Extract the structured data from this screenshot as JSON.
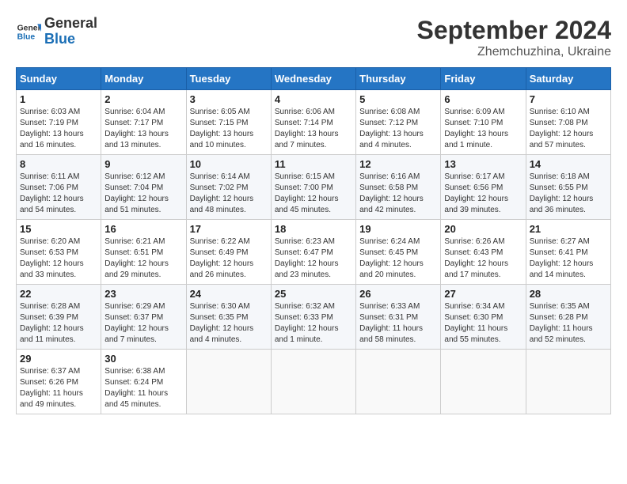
{
  "header": {
    "logo_general": "General",
    "logo_blue": "Blue",
    "month_title": "September 2024",
    "location": "Zhemchuzhina, Ukraine"
  },
  "calendar": {
    "days_of_week": [
      "Sunday",
      "Monday",
      "Tuesday",
      "Wednesday",
      "Thursday",
      "Friday",
      "Saturday"
    ],
    "weeks": [
      [
        null,
        {
          "day": "2",
          "sunrise": "6:04 AM",
          "sunset": "7:17 PM",
          "daylight": "13 hours and 13 minutes."
        },
        {
          "day": "3",
          "sunrise": "6:05 AM",
          "sunset": "7:15 PM",
          "daylight": "13 hours and 10 minutes."
        },
        {
          "day": "4",
          "sunrise": "6:06 AM",
          "sunset": "7:14 PM",
          "daylight": "13 hours and 7 minutes."
        },
        {
          "day": "5",
          "sunrise": "6:08 AM",
          "sunset": "7:12 PM",
          "daylight": "13 hours and 4 minutes."
        },
        {
          "day": "6",
          "sunrise": "6:09 AM",
          "sunset": "7:10 PM",
          "daylight": "13 hours and 1 minute."
        },
        {
          "day": "7",
          "sunrise": "6:10 AM",
          "sunset": "7:08 PM",
          "daylight": "12 hours and 57 minutes."
        }
      ],
      [
        {
          "day": "1",
          "sunrise": "6:03 AM",
          "sunset": "7:19 PM",
          "daylight": "13 hours and 16 minutes."
        },
        null,
        null,
        null,
        null,
        null,
        null
      ],
      [
        {
          "day": "8",
          "sunrise": "6:11 AM",
          "sunset": "7:06 PM",
          "daylight": "12 hours and 54 minutes."
        },
        {
          "day": "9",
          "sunrise": "6:12 AM",
          "sunset": "7:04 PM",
          "daylight": "12 hours and 51 minutes."
        },
        {
          "day": "10",
          "sunrise": "6:14 AM",
          "sunset": "7:02 PM",
          "daylight": "12 hours and 48 minutes."
        },
        {
          "day": "11",
          "sunrise": "6:15 AM",
          "sunset": "7:00 PM",
          "daylight": "12 hours and 45 minutes."
        },
        {
          "day": "12",
          "sunrise": "6:16 AM",
          "sunset": "6:58 PM",
          "daylight": "12 hours and 42 minutes."
        },
        {
          "day": "13",
          "sunrise": "6:17 AM",
          "sunset": "6:56 PM",
          "daylight": "12 hours and 39 minutes."
        },
        {
          "day": "14",
          "sunrise": "6:18 AM",
          "sunset": "6:55 PM",
          "daylight": "12 hours and 36 minutes."
        }
      ],
      [
        {
          "day": "15",
          "sunrise": "6:20 AM",
          "sunset": "6:53 PM",
          "daylight": "12 hours and 33 minutes."
        },
        {
          "day": "16",
          "sunrise": "6:21 AM",
          "sunset": "6:51 PM",
          "daylight": "12 hours and 29 minutes."
        },
        {
          "day": "17",
          "sunrise": "6:22 AM",
          "sunset": "6:49 PM",
          "daylight": "12 hours and 26 minutes."
        },
        {
          "day": "18",
          "sunrise": "6:23 AM",
          "sunset": "6:47 PM",
          "daylight": "12 hours and 23 minutes."
        },
        {
          "day": "19",
          "sunrise": "6:24 AM",
          "sunset": "6:45 PM",
          "daylight": "12 hours and 20 minutes."
        },
        {
          "day": "20",
          "sunrise": "6:26 AM",
          "sunset": "6:43 PM",
          "daylight": "12 hours and 17 minutes."
        },
        {
          "day": "21",
          "sunrise": "6:27 AM",
          "sunset": "6:41 PM",
          "daylight": "12 hours and 14 minutes."
        }
      ],
      [
        {
          "day": "22",
          "sunrise": "6:28 AM",
          "sunset": "6:39 PM",
          "daylight": "12 hours and 11 minutes."
        },
        {
          "day": "23",
          "sunrise": "6:29 AM",
          "sunset": "6:37 PM",
          "daylight": "12 hours and 7 minutes."
        },
        {
          "day": "24",
          "sunrise": "6:30 AM",
          "sunset": "6:35 PM",
          "daylight": "12 hours and 4 minutes."
        },
        {
          "day": "25",
          "sunrise": "6:32 AM",
          "sunset": "6:33 PM",
          "daylight": "12 hours and 1 minute."
        },
        {
          "day": "26",
          "sunrise": "6:33 AM",
          "sunset": "6:31 PM",
          "daylight": "11 hours and 58 minutes."
        },
        {
          "day": "27",
          "sunrise": "6:34 AM",
          "sunset": "6:30 PM",
          "daylight": "11 hours and 55 minutes."
        },
        {
          "day": "28",
          "sunrise": "6:35 AM",
          "sunset": "6:28 PM",
          "daylight": "11 hours and 52 minutes."
        }
      ],
      [
        {
          "day": "29",
          "sunrise": "6:37 AM",
          "sunset": "6:26 PM",
          "daylight": "11 hours and 49 minutes."
        },
        {
          "day": "30",
          "sunrise": "6:38 AM",
          "sunset": "6:24 PM",
          "daylight": "11 hours and 45 minutes."
        },
        null,
        null,
        null,
        null,
        null
      ]
    ]
  }
}
